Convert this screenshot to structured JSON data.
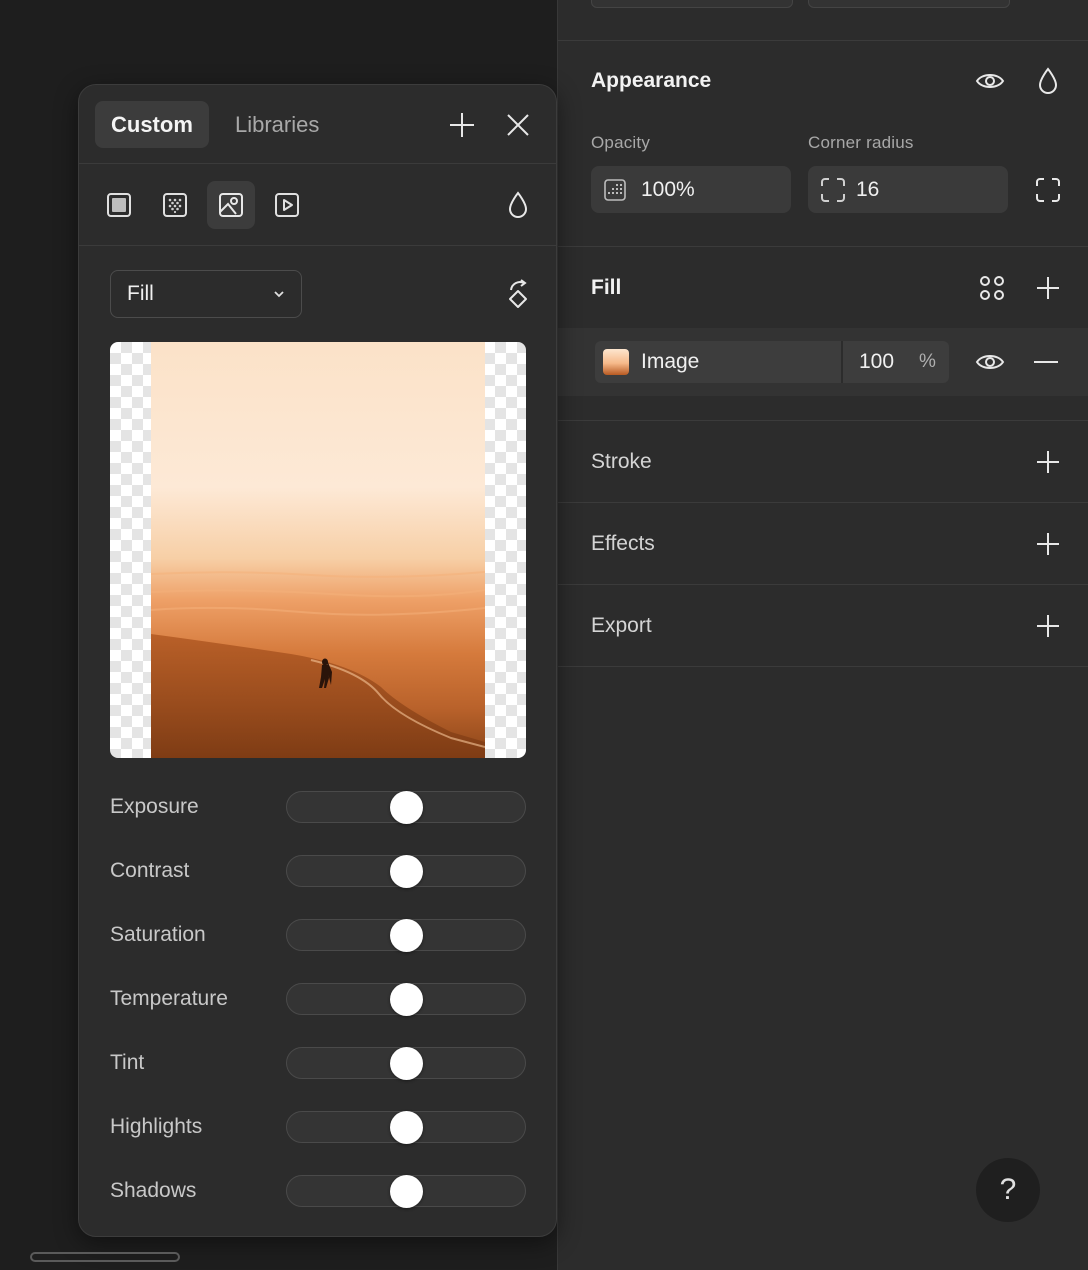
{
  "inspector": {
    "appearance": {
      "title": "Appearance",
      "icons": [
        "eye-icon",
        "drop-icon"
      ],
      "opacity_label": "Opacity",
      "opacity_value": "100%",
      "radius_label": "Corner radius",
      "radius_value": "16"
    },
    "fill": {
      "title": "Fill",
      "icons": [
        "styles-grid-icon",
        "plus-icon"
      ],
      "item": {
        "name": "Image",
        "opacity": "100",
        "unit": "%"
      }
    },
    "stroke": {
      "title": "Stroke"
    },
    "effects": {
      "title": "Effects"
    },
    "export": {
      "title": "Export"
    },
    "help": "?"
  },
  "picker": {
    "tabs": [
      {
        "label": "Custom",
        "active": true
      },
      {
        "label": "Libraries",
        "active": false
      }
    ],
    "fill_types": [
      "solid-fill-icon",
      "gradient-fill-icon",
      "image-fill-icon",
      "video-fill-icon"
    ],
    "active_fill_type": "image-fill-icon",
    "mode": "Fill",
    "adjustments": [
      {
        "label": "Exposure",
        "value": 0.5
      },
      {
        "label": "Contrast",
        "value": 0.5
      },
      {
        "label": "Saturation",
        "value": 0.5
      },
      {
        "label": "Temperature",
        "value": 0.5
      },
      {
        "label": "Tint",
        "value": 0.5
      },
      {
        "label": "Highlights",
        "value": 0.5
      },
      {
        "label": "Shadows",
        "value": 0.5
      }
    ]
  }
}
